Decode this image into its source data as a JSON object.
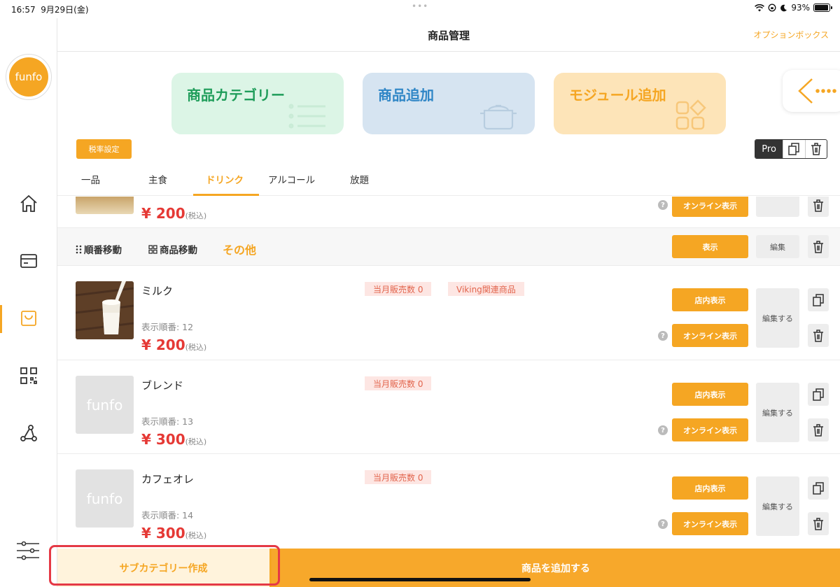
{
  "status": {
    "time": "16:57",
    "date": "9月29日(金)",
    "battery": "93%",
    "battery_level": 0.93
  },
  "header": {
    "title": "商品管理",
    "option_box": "オプションボックス"
  },
  "logo": {
    "text": "funfo"
  },
  "cards": {
    "category": "商品カテゴリー",
    "add_product": "商品追加",
    "add_module": "モジュール追加"
  },
  "tax_button": "税率設定",
  "pro_label": "Pro",
  "tabs": [
    {
      "label": "一品"
    },
    {
      "label": "主食"
    },
    {
      "label": "ドリンク"
    },
    {
      "label": "アルコール"
    },
    {
      "label": "放題"
    }
  ],
  "partial_row": {
    "price": "¥ 200",
    "tax": "(税込)",
    "online_button": "オンライン表示"
  },
  "subcategory": {
    "reorder": "順番移動",
    "move": "商品移動",
    "name": "その他",
    "show_button": "表示",
    "edit_button": "編集"
  },
  "products": [
    {
      "name": "ミルク",
      "order": "表示順番: 12",
      "price": "¥ 200",
      "tax": "(税込)",
      "sales_tag": "当月販売数 0",
      "viking_tag": "Viking関連商品",
      "store_button": "店内表示",
      "online_button": "オンライン表示",
      "edit_button": "編集する",
      "has_image": true
    },
    {
      "name": "ブレンド",
      "order": "表示順番: 13",
      "price": "¥ 300",
      "tax": "(税込)",
      "sales_tag": "当月販売数 0",
      "store_button": "店内表示",
      "online_button": "オンライン表示",
      "edit_button": "編集する",
      "placeholder": "funfo"
    },
    {
      "name": "カフェオレ",
      "order": "表示順番: 14",
      "price": "¥ 300",
      "tax": "(税込)",
      "sales_tag": "当月販売数 0",
      "store_button": "店内表示",
      "online_button": "オンライン表示",
      "edit_button": "編集する",
      "placeholder": "funfo"
    }
  ],
  "bottom": {
    "create_subcategory": "サブカテゴリー作成",
    "add_product": "商品を追加する"
  },
  "colors": {
    "accent": "#f5a623",
    "price": "#e53935",
    "highlight": "#e53945"
  },
  "icons": [
    "home-icon",
    "card-icon",
    "bag-icon",
    "qr-icon",
    "network-icon",
    "settings-sliders-icon",
    "copy-icon",
    "trash-icon",
    "back-dots-icon",
    "help-icon"
  ]
}
